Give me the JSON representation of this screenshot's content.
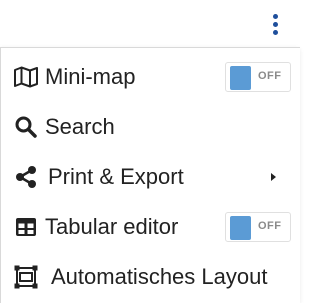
{
  "menu": {
    "items": [
      {
        "label": "Mini-map",
        "icon": "map-icon",
        "toggle": {
          "state": "OFF",
          "on": false
        }
      },
      {
        "label": "Search",
        "icon": "search-icon"
      },
      {
        "label": "Print & Export",
        "icon": "share-icon",
        "has_submenu": true
      },
      {
        "label": "Tabular editor",
        "icon": "table-icon",
        "toggle": {
          "state": "OFF",
          "on": false
        }
      },
      {
        "label": "Automatisches Layout",
        "icon": "auto-layout-icon"
      }
    ]
  },
  "colors": {
    "kebab": "#1f4f9c",
    "toggle_knob": "#5b9bd5",
    "text": "#222222",
    "toggle_text": "#8a8a8a"
  }
}
